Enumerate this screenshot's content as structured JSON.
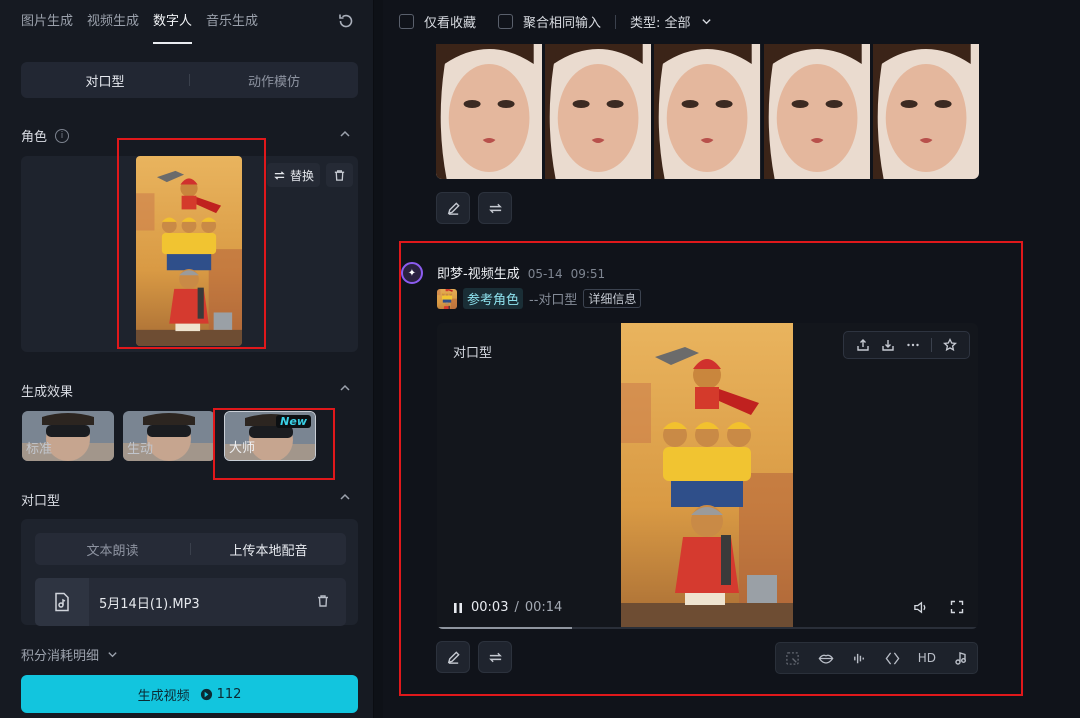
{
  "left": {
    "tabs": [
      "图片生成",
      "视频生成",
      "数字人",
      "音乐生成"
    ],
    "active_tab": "数字人",
    "mode_seg": {
      "option1": "对口型",
      "option2": "动作模仿"
    },
    "role_section": {
      "title": "角色",
      "replace_label": "替换"
    },
    "effects_section": {
      "title": "生成效果",
      "items": [
        {
          "label": "标准"
        },
        {
          "label": "生动"
        },
        {
          "label": "大师",
          "badge": "New"
        }
      ]
    },
    "lip_section": {
      "title": "对口型",
      "seg": {
        "option1": "文本朗读",
        "option2": "上传本地配音"
      },
      "file_name": "5月14日(1).MP3"
    },
    "credits_label": "积分消耗明细",
    "generate": {
      "label": "生成视频",
      "cost": "112"
    }
  },
  "right": {
    "filters": {
      "favorites": "仅看收藏",
      "merge": "聚合相同输入",
      "type": "类型: 全部"
    },
    "message": {
      "title": "即梦-视频生成",
      "date": "05-14",
      "time": "09:51",
      "ref_name": "参考角色",
      "ref_type": "--对口型",
      "detail": "详细信息"
    },
    "player": {
      "label": "对口型",
      "current": "00:03",
      "separator": "/",
      "duration": "00:14",
      "progress": 0.25
    },
    "tools_bar": {
      "hd": "HD"
    }
  },
  "colors": {
    "accent": "#12c5de",
    "highlight_box": "#e0181b",
    "bot_ring": "#8c5cf0"
  }
}
